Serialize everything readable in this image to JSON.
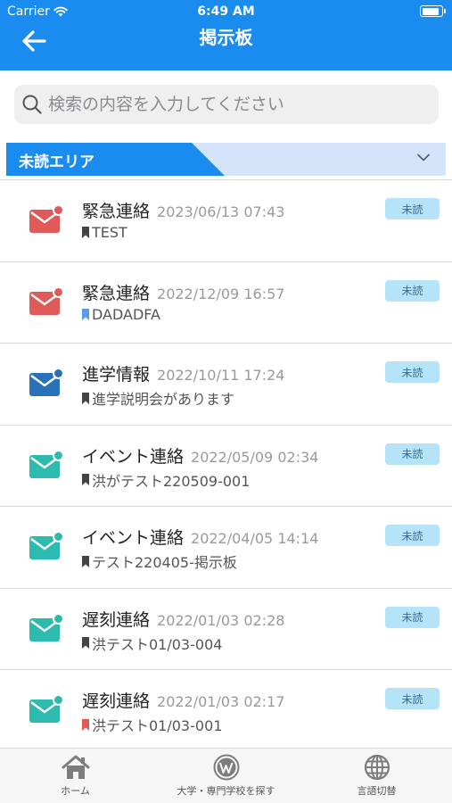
{
  "status_bar": {
    "carrier": "Carrier",
    "time": "6:49 AM"
  },
  "header": {
    "title": "掲示板"
  },
  "search": {
    "placeholder": "検索の内容を入力してください"
  },
  "section": {
    "title": "未読エリア"
  },
  "colors": {
    "header": "#1a8cf0",
    "urgent": "#e05a5a",
    "academic": "#2a72b8",
    "event": "#2dbbb0",
    "late": "#2dbbb0",
    "badge_bg": "#b5e4f8"
  },
  "messages": [
    {
      "category": "緊急連絡",
      "date": "2023/06/13 07:43",
      "subtitle": "TEST",
      "badge": "未読",
      "icon": "mail-icon",
      "icon_color": "#e05a5a",
      "bookmark_color": "#444444"
    },
    {
      "category": "緊急連絡",
      "date": "2022/12/09 16:57",
      "subtitle": "DADADFA",
      "badge": "未読",
      "icon": "mail-icon",
      "icon_color": "#e05a5a",
      "bookmark_color": "#5b9bea"
    },
    {
      "category": "進学情報",
      "date": "2022/10/11 17:24",
      "subtitle": "進学説明会があります",
      "badge": "未読",
      "icon": "mail-icon",
      "icon_color": "#2a72b8",
      "bookmark_color": "#444444"
    },
    {
      "category": "イベント連絡",
      "date": "2022/05/09 02:34",
      "subtitle": "洪がテスト220509-001",
      "badge": "未読",
      "icon": "mail-icon",
      "icon_color": "#2dbbb0",
      "bookmark_color": "#444444"
    },
    {
      "category": "イベント連絡",
      "date": "2022/04/05 14:14",
      "subtitle": "テスト220405-掲示板",
      "badge": "未読",
      "icon": "mail-icon",
      "icon_color": "#2dbbb0",
      "bookmark_color": "#444444"
    },
    {
      "category": "遅刻連絡",
      "date": "2022/01/03 02:28",
      "subtitle": "洪テスト01/03-004",
      "badge": "未読",
      "icon": "mail-icon",
      "icon_color": "#2dbbb0",
      "bookmark_color": "#444444"
    },
    {
      "category": "遅刻連絡",
      "date": "2022/01/03 02:17",
      "subtitle": "洪テスト01/03-001",
      "badge": "未読",
      "icon": "mail-icon",
      "icon_color": "#2dbbb0",
      "bookmark_color": "#e05a5a"
    }
  ],
  "tabbar": {
    "tabs": [
      {
        "label": "ホーム",
        "icon": "home-icon"
      },
      {
        "label": "大学・専門学校を探す",
        "icon": "wordpress-icon"
      },
      {
        "label": "言語切替",
        "icon": "globe-icon"
      }
    ]
  }
}
